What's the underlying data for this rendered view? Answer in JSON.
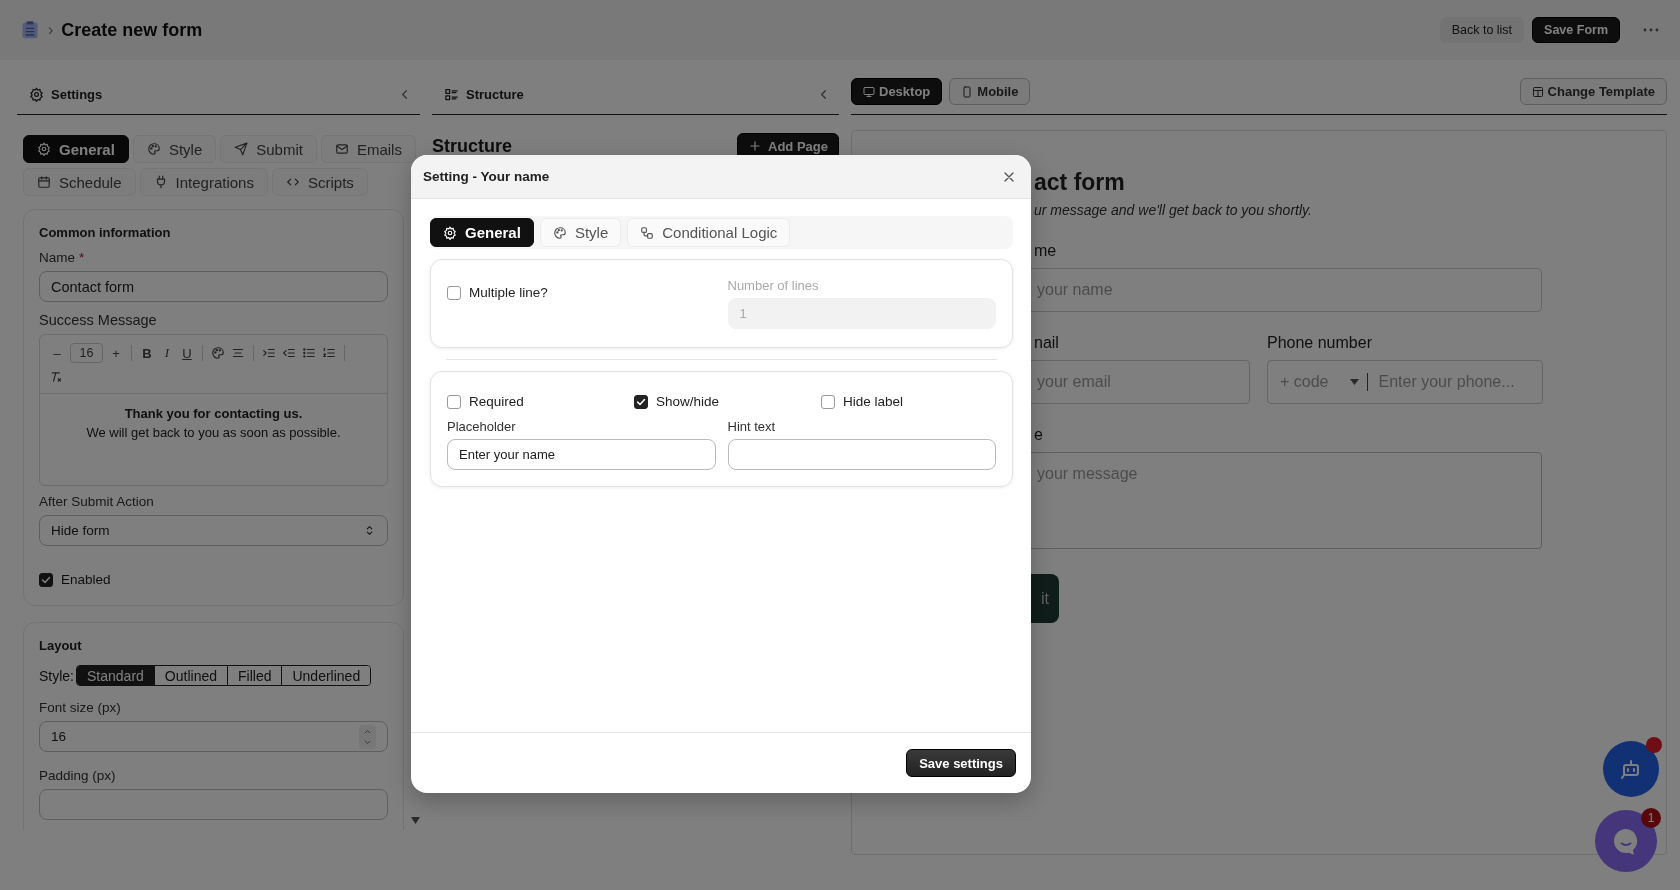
{
  "app_header": {
    "separator": "›",
    "title": "Create new form",
    "buttons": [
      {
        "label": "Back to list",
        "kind": "secondary"
      },
      {
        "label": "Save Form",
        "kind": "primary"
      }
    ]
  },
  "settings_panel": {
    "title": "Settings",
    "tabs": [
      {
        "label": "General",
        "selected": true
      },
      {
        "label": "Style",
        "selected": false
      },
      {
        "label": "Submit",
        "selected": false
      },
      {
        "label": "Emails",
        "selected": false
      },
      {
        "label": "Schedule",
        "selected": false
      },
      {
        "label": "Integrations",
        "selected": false
      },
      {
        "label": "Scripts",
        "selected": false
      }
    ],
    "common": {
      "heading": "Common information",
      "name_label": "Name",
      "required_mark": "*",
      "name_value": "Contact form",
      "success_label": "Success Message",
      "editor": {
        "minus": "–",
        "font_size": "16",
        "plus": "+",
        "bold": "B",
        "italic": "I",
        "underline": "U",
        "content_bold": "Thank you for contacting us.",
        "content": "We will get back to you as soon as possible."
      },
      "after_submit_label": "After Submit Action",
      "after_submit_value": "Hide form",
      "enabled": {
        "label": "Enabled",
        "checked": true
      }
    },
    "layout": {
      "heading": "Layout",
      "style_label": "Style:",
      "style_options": [
        {
          "label": "Standard",
          "selected": true
        },
        {
          "label": "Outlined",
          "selected": false
        },
        {
          "label": "Filled",
          "selected": false
        },
        {
          "label": "Underlined",
          "selected": false
        }
      ],
      "font_size_label": "Font size (px)",
      "font_size_value": "16",
      "padding_label": "Padding (px)"
    }
  },
  "structure_panel": {
    "title": "Structure",
    "heading": "Structure",
    "add_page": "Add Page"
  },
  "preview_panel": {
    "view_tabs": [
      {
        "label": "Desktop",
        "selected": true
      },
      {
        "label": "Mobile",
        "selected": false
      }
    ],
    "change_template": "Change Template",
    "form": {
      "title": "act form",
      "subtitle": "ur message and we'll get back to you shortly.",
      "name_label": "me",
      "name_placeholder": "your name",
      "email_label": "nail",
      "email_placeholder": "your email",
      "phone_label": "Phone number",
      "phone_code": "+ code",
      "phone_placeholder": "Enter your phone...",
      "message_label": "e",
      "message_placeholder": "your message",
      "submit": "it"
    }
  },
  "chat_widgets": {
    "chat_badge": "1"
  },
  "modal": {
    "title": "Setting - Your name",
    "tabs": [
      {
        "label": "General",
        "selected": true
      },
      {
        "label": "Style",
        "selected": false
      },
      {
        "label": "Conditional Logic",
        "selected": false
      }
    ],
    "multiple_line": {
      "label": "Multiple line?",
      "checked": false
    },
    "lines_label": "Number of lines",
    "lines_value": "1",
    "lines_disabled": true,
    "options": [
      {
        "label": "Required",
        "checked": false
      },
      {
        "label": "Show/hide",
        "checked": true
      },
      {
        "label": "Hide label",
        "checked": false
      }
    ],
    "placeholder_label": "Placeholder",
    "placeholder_value": "Enter your name",
    "hint_label": "Hint text",
    "save": "Save settings"
  }
}
